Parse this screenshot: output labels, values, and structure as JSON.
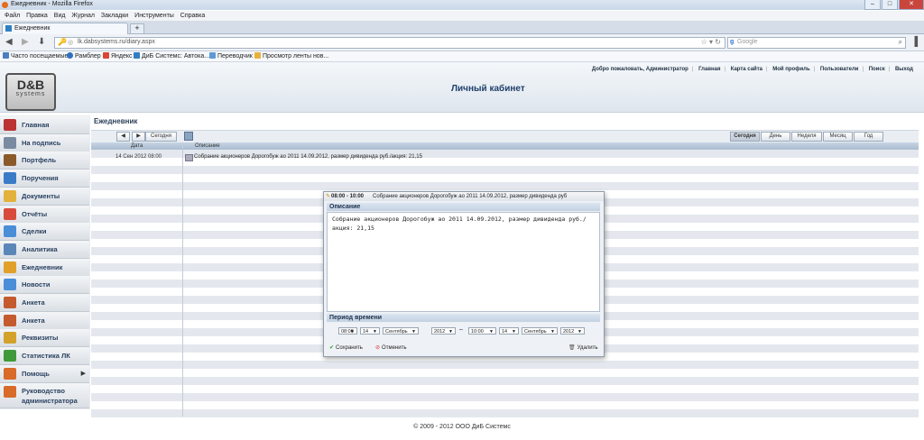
{
  "browser": {
    "window_title": "Ежедневник - Mozilla Firefox",
    "menu": [
      "Файл",
      "Правка",
      "Вид",
      "Журнал",
      "Закладки",
      "Инструменты",
      "Справка"
    ],
    "tab_label": "Ежедневник",
    "new_tab": "+",
    "url": "lk.dabsystems.ru/diary.aspx",
    "search_placeholder": "Google",
    "search_engine_letter": "g",
    "bookmarks": [
      "Часто посещаемые",
      "Рамблер",
      "Яндекс",
      "ДиБ Системс: Автока...",
      "Переводчик",
      "Просмотр ленты нов..."
    ]
  },
  "site": {
    "logo_top": "D&B",
    "logo_bottom": "systems",
    "page_title": "Личный кабинет",
    "top_links": [
      "Добро пожаловать, Администратор",
      "Главная",
      "Карта сайта",
      "Мой профиль",
      "Пользователи",
      "Поиск",
      "Выход"
    ]
  },
  "sidebar": {
    "items": [
      {
        "label": "Главная",
        "icon": "home-icon",
        "color": "#b33"
      },
      {
        "label": "На подпись",
        "icon": "signature-icon",
        "color": "#7a8aa0"
      },
      {
        "label": "Портфель",
        "icon": "briefcase-icon",
        "color": "#8a5a2b"
      },
      {
        "label": "Поручения",
        "icon": "person-icon",
        "color": "#3a7bc8"
      },
      {
        "label": "Документы",
        "icon": "folder-icon",
        "color": "#e3b23c"
      },
      {
        "label": "Отчёты",
        "icon": "chart-icon",
        "color": "#d84b3c"
      },
      {
        "label": "Сделки",
        "icon": "deals-icon",
        "color": "#4a8ed8"
      },
      {
        "label": "Аналитика",
        "icon": "analytics-icon",
        "color": "#5b86b8"
      },
      {
        "label": "Ежедневник",
        "icon": "diary-icon",
        "color": "#e0a02a"
      },
      {
        "label": "Новости",
        "icon": "news-icon",
        "color": "#4a8ed8"
      },
      {
        "label": "Анкета",
        "icon": "profile-icon",
        "color": "#c45a2e"
      },
      {
        "label": "Анкета",
        "icon": "profile-icon",
        "color": "#c45a2e"
      },
      {
        "label": "Реквизиты",
        "icon": "coins-icon",
        "color": "#d4a12a"
      },
      {
        "label": "Статистика ЛК",
        "icon": "stats-icon",
        "color": "#3f9a3a"
      },
      {
        "label": "Помощь",
        "icon": "lifebuoy-icon",
        "color": "#d86a2a",
        "arrow": "▶"
      },
      {
        "label": "Руководство администратора",
        "icon": "lifebuoy-icon",
        "color": "#d86a2a"
      }
    ]
  },
  "main": {
    "breadcrumb": "Ежедневник",
    "prev_label": "◀",
    "next_label": "▶",
    "today_button": "Сегодня",
    "views": [
      "Сегодня",
      "День",
      "Неделя",
      "Месяц",
      "Год"
    ],
    "columns": [
      "Дата",
      "Описание"
    ],
    "events": [
      {
        "date": "14 Сен 2012 08:00",
        "text": "Собрание акционеров Дорогобуж ао 2011 14.09.2012, размер дивиденда руб./акция: 21,15"
      }
    ]
  },
  "dialog": {
    "time_range": "08:00 - 10:00",
    "header_text": "Собрание акционеров Дорогобуж ао 2011 14.09.2012, размер дивиденда руб",
    "description_label": "Описание",
    "description_value": "Собрание акционеров Дорогобуж ао 2011 14.09.2012, размер дивиденда руб./акция: 21,15",
    "period_label": "Период времени",
    "start": {
      "time": "08:00",
      "day": "14",
      "month": "Сентябрь",
      "year": "2012"
    },
    "separator": "–",
    "end": {
      "time": "10:00",
      "day": "14",
      "month": "Сентябрь",
      "year": "2012"
    },
    "save": "Сохранить",
    "cancel": "Отменить",
    "delete": "Удалить"
  },
  "footer": "© 2009 - 2012 ООО ДиБ Системс"
}
